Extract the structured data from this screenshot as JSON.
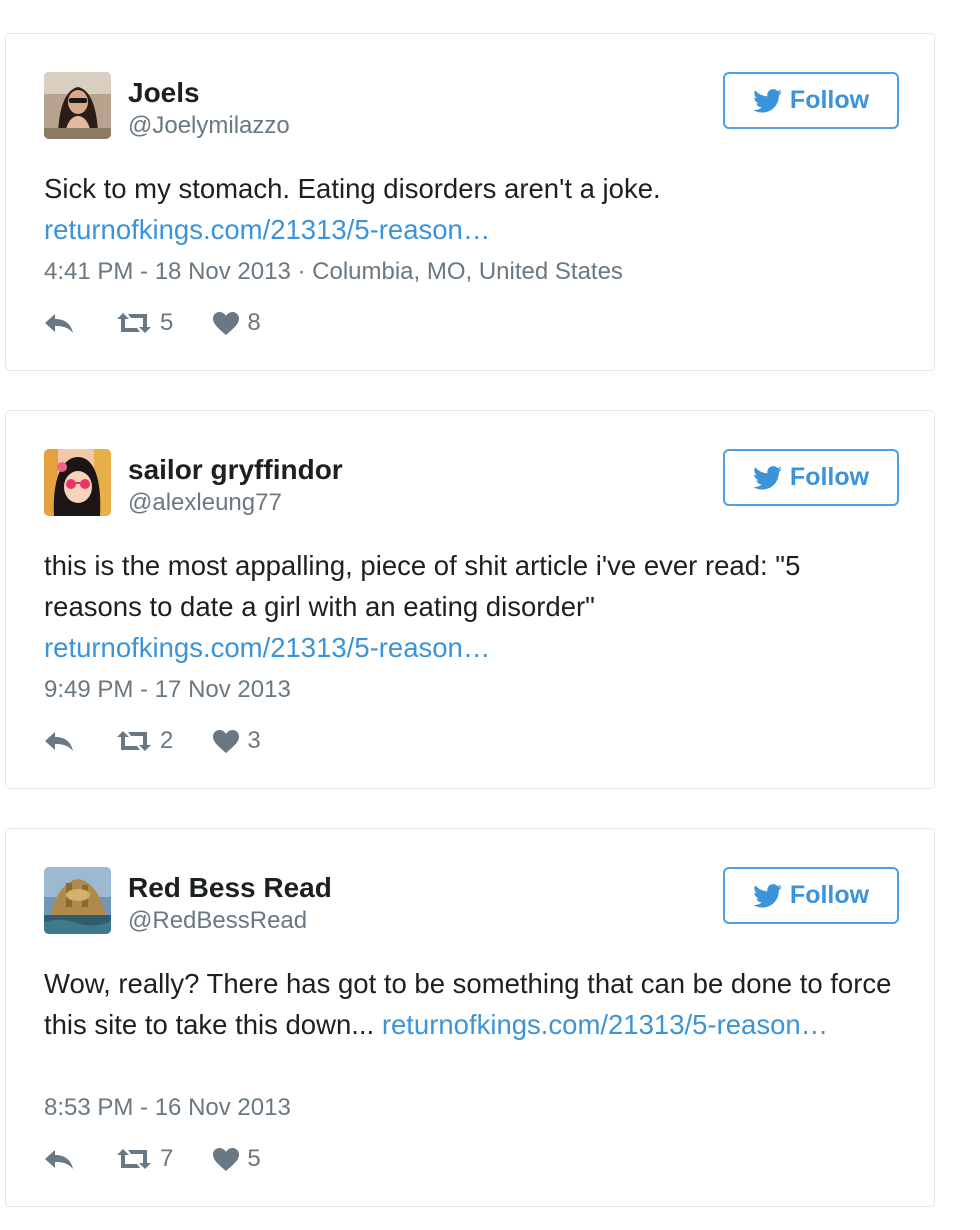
{
  "tweets": [
    {
      "name": "Joels",
      "handle": "@Joelymilazzo",
      "follow_label": "Follow",
      "text": "Sick to my stomach. Eating disorders aren't a joke.",
      "link": "returnofkings.com/21313/5-reason…",
      "time": "4:41 PM - 18 Nov 2013 · Columbia, MO, United States",
      "retweets": "5",
      "likes": "8"
    },
    {
      "name": "sailor gryffindor",
      "handle": "@alexleung77",
      "follow_label": "Follow",
      "text": "this is the most appalling, piece of shit article i've ever read: \"5 reasons to date a girl with an eating disorder\"",
      "link": "returnofkings.com/21313/5-reason…",
      "time": "9:49 PM - 17 Nov 2013",
      "retweets": "2",
      "likes": "3"
    },
    {
      "name": "Red Bess Read",
      "handle": "@RedBessRead",
      "follow_label": "Follow",
      "text": "Wow, really? There has got to be something that can be done to force this site to take this down... ",
      "link": "returnofkings.com/21313/5-reason…",
      "time": "8:53 PM - 16 Nov 2013",
      "retweets": "7",
      "likes": "5"
    }
  ],
  "icons": {
    "follow": "twitter-bird-icon",
    "reply": "reply-icon",
    "retweet": "retweet-icon",
    "like": "heart-icon"
  },
  "colors": {
    "link": "#3b94d9",
    "muted": "#697882",
    "border": "#e1e8ed",
    "text": "#1c2022"
  }
}
